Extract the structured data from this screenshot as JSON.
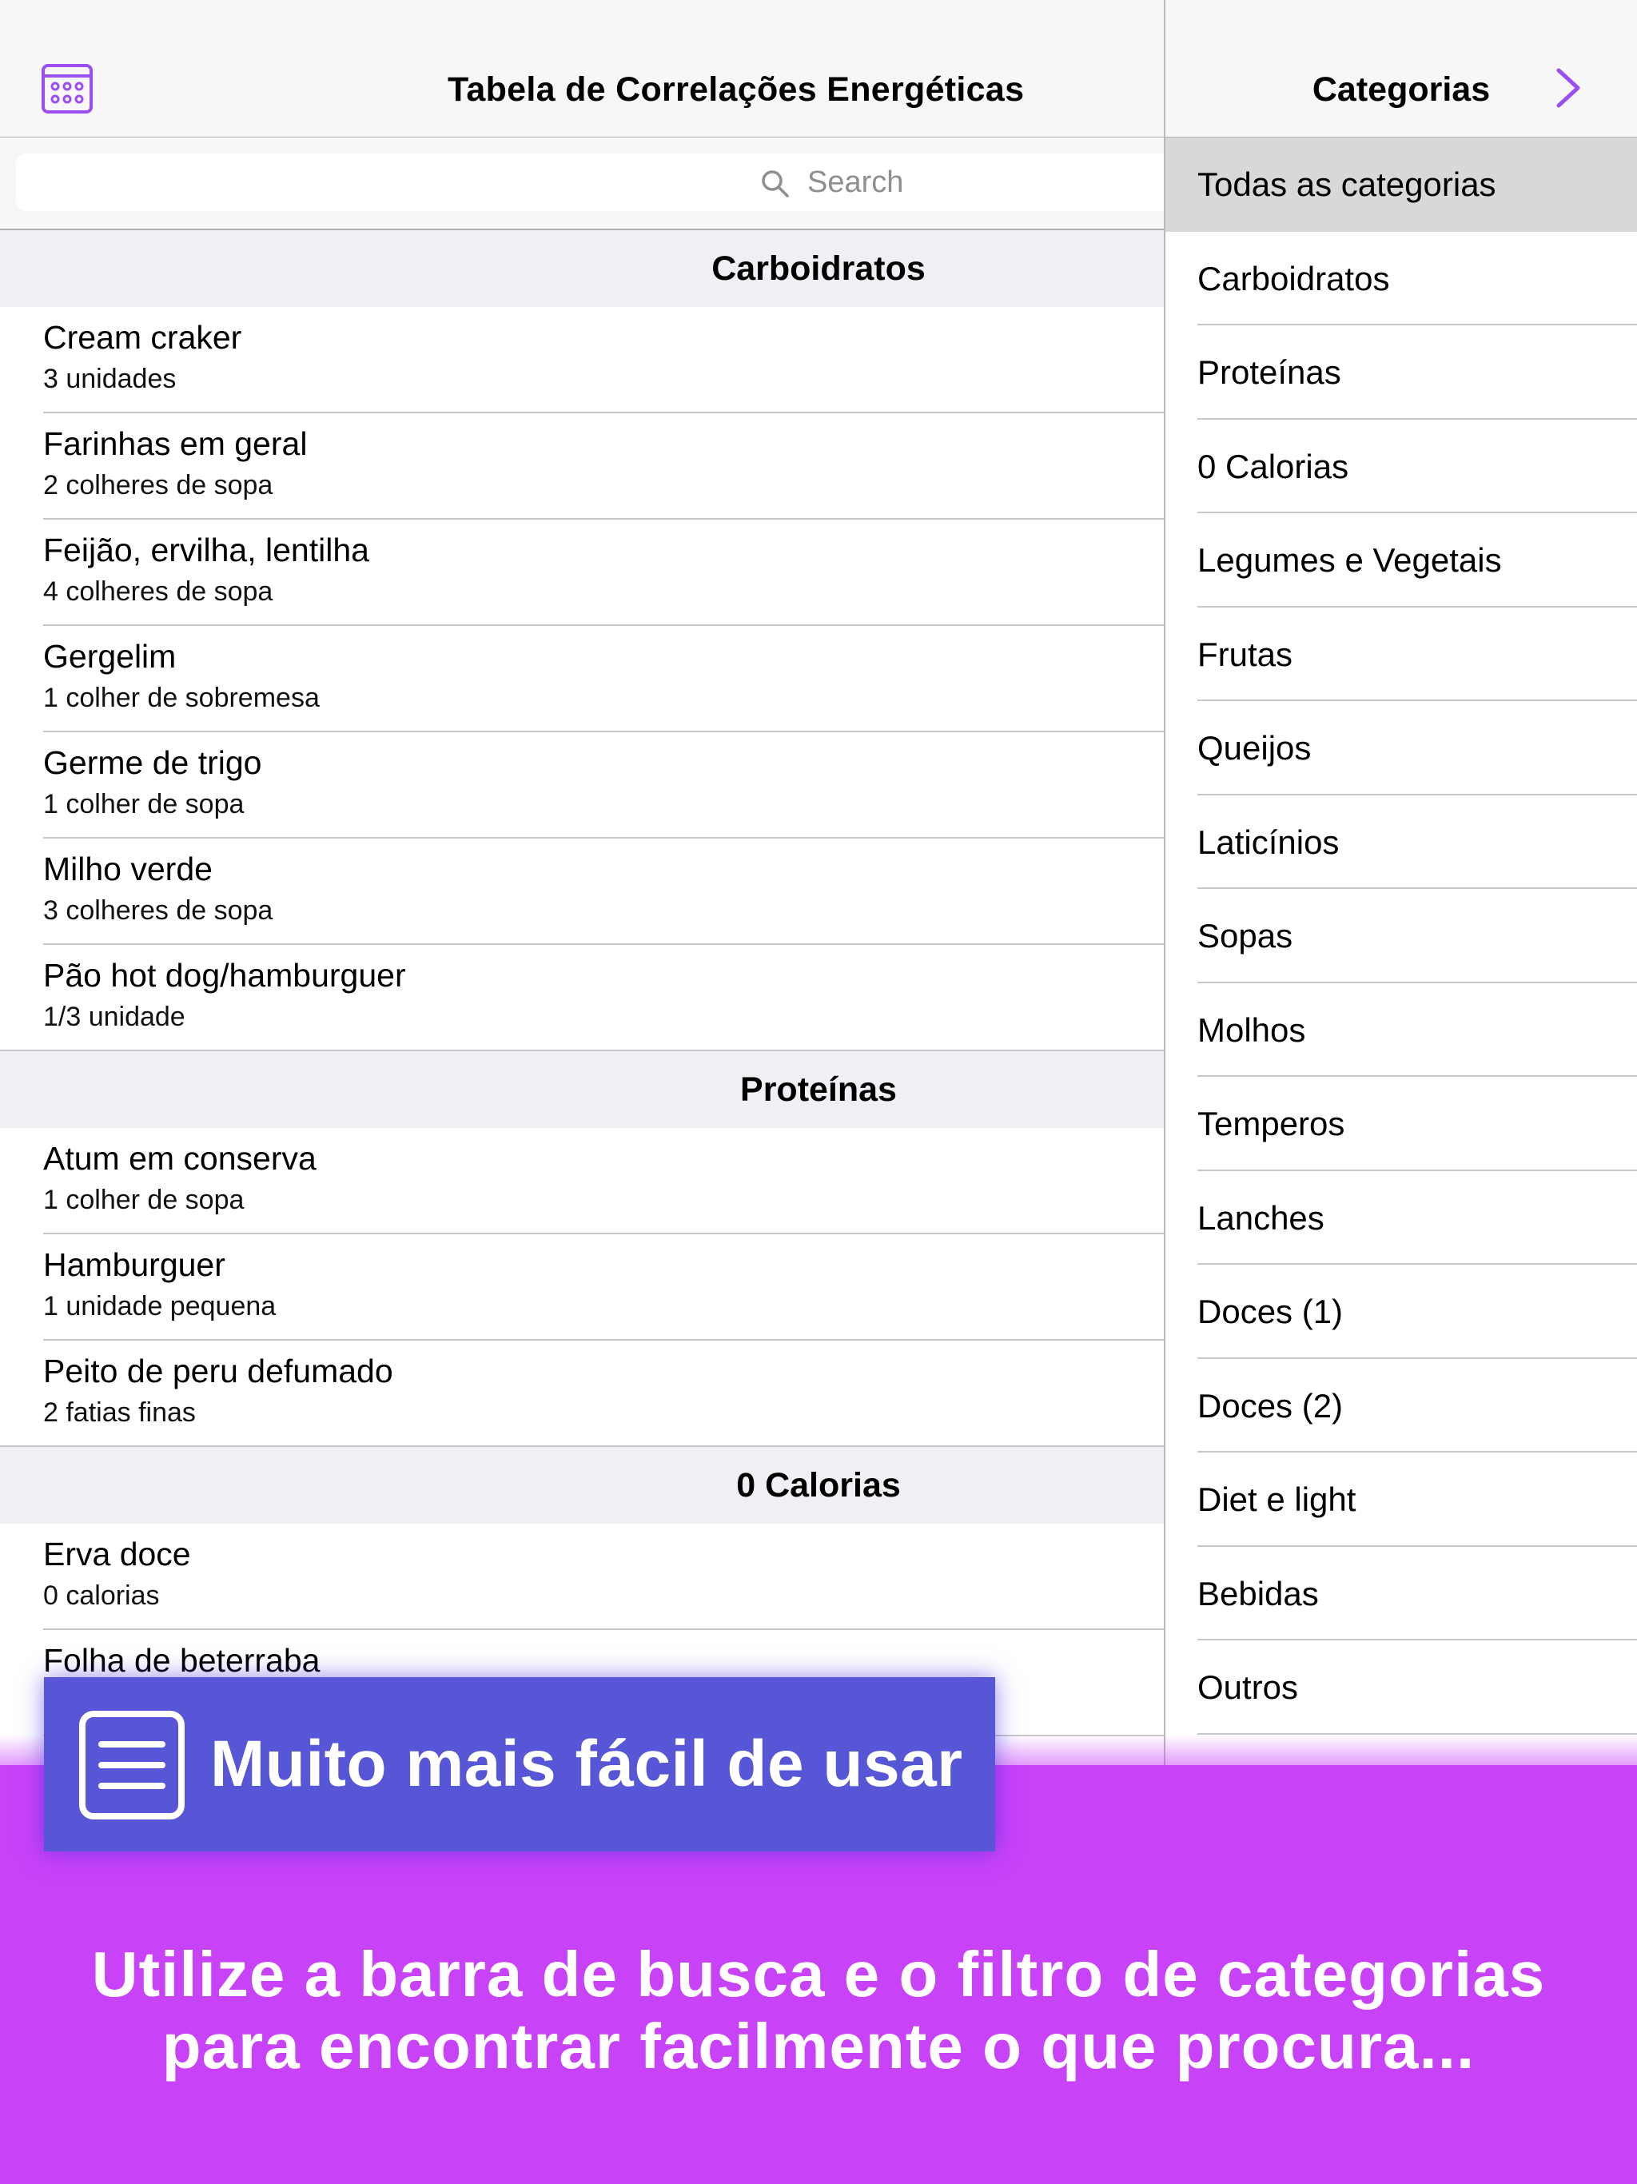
{
  "left_nav": {
    "title": "Tabela de Correlações Energéticas",
    "calendar_icon": "calendar-grid-icon"
  },
  "search": {
    "placeholder": "Search",
    "icon": "search-icon"
  },
  "sections": [
    {
      "title": "Carboidratos",
      "items": [
        {
          "name": "Cream craker",
          "portion": "3 unidades"
        },
        {
          "name": "Farinhas em geral",
          "portion": "2 colheres de sopa"
        },
        {
          "name": "Feijão, ervilha, lentilha",
          "portion": "4 colheres de sopa"
        },
        {
          "name": "Gergelim",
          "portion": "1 colher de sobremesa"
        },
        {
          "name": "Germe de trigo",
          "portion": "1 colher de sopa"
        },
        {
          "name": "Milho verde",
          "portion": "3 colheres de sopa"
        },
        {
          "name": "Pão hot dog/hamburguer",
          "portion": "1/3 unidade"
        }
      ]
    },
    {
      "title": "Proteínas",
      "items": [
        {
          "name": "Atum em conserva",
          "portion": "1 colher de sopa"
        },
        {
          "name": "Hamburguer",
          "portion": "1 unidade pequena"
        },
        {
          "name": "Peito de peru defumado",
          "portion": "2 fatias finas"
        }
      ]
    },
    {
      "title": "0 Calorias",
      "items": [
        {
          "name": "Erva doce",
          "portion": "0 calorias"
        },
        {
          "name": "Folha de beterraba",
          "portion": ""
        }
      ]
    }
  ],
  "categories_nav": {
    "title": "Categorias",
    "chevron_icon": "chevron-right-icon"
  },
  "categories": [
    "Todas as categorias",
    "Carboidratos",
    "Proteínas",
    "0 Calorias",
    "Legumes e Vegetais",
    "Frutas",
    "Queijos",
    "Laticínios",
    "Sopas",
    "Molhos",
    "Temperos",
    "Lanches",
    "Doces (1)",
    "Doces (2)",
    "Diet e light",
    "Bebidas",
    "Outros"
  ],
  "selected_category_index": 0,
  "promo": {
    "heading": "Muito mais fácil de usar",
    "subtitle_line1": "Utilize a barra de busca e o filtro de categorias",
    "subtitle_line2": "para encontrar facilmente o que procura...",
    "icon": "document-list-icon"
  },
  "colors": {
    "accent_purple": "#9b4ff0",
    "promo_background": "#c842f8",
    "promo_banner": "#5656d6",
    "section_header_bg": "#efeff4",
    "selected_row_bg": "#d8d8d8"
  }
}
